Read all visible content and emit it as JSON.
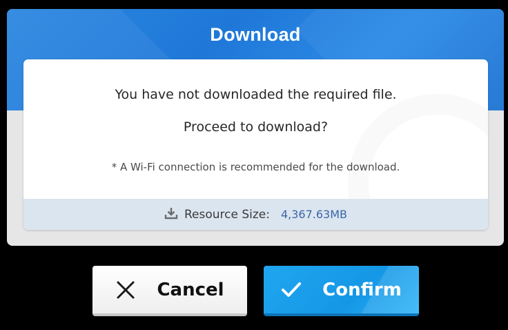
{
  "dialog": {
    "title": "Download",
    "message_line1": "You have not downloaded the required file.",
    "message_line2": "Proceed to download?",
    "note": "* A Wi-Fi connection is recommended for the download.",
    "resource_size_label": "Resource Size:",
    "resource_size_value": "4,367.63MB",
    "download_icon": "download-tray-icon"
  },
  "buttons": {
    "cancel": {
      "label": "Cancel",
      "icon": "close-icon"
    },
    "confirm": {
      "label": "Confirm",
      "icon": "checkmark-icon"
    }
  },
  "colors": {
    "header_blue": "#2a86e0",
    "confirm_blue": "#1597e6",
    "size_value_blue": "#3b66a8",
    "size_bar_bg": "#dbe5ef"
  }
}
